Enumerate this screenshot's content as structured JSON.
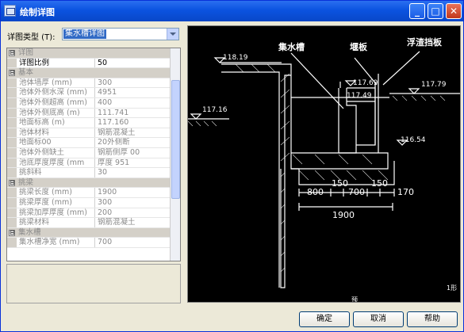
{
  "window": {
    "title": "绘制详图"
  },
  "titlebar": {
    "minimize": "_",
    "maximize": "□",
    "close": "✕"
  },
  "detail_type": {
    "label": "详图类型 (T):",
    "selected": "集水槽详图"
  },
  "properties": [
    {
      "kind": "cat",
      "toggle": "⊟",
      "name": "详图"
    },
    {
      "kind": "prop",
      "name": "详图比例",
      "value": "50",
      "active": true
    },
    {
      "kind": "cat",
      "toggle": "⊟",
      "name": "基本"
    },
    {
      "kind": "prop",
      "name": "池体墙厚 (mm)",
      "value": "300"
    },
    {
      "kind": "prop",
      "name": "池体外侧水深 (mm)",
      "value": "4951"
    },
    {
      "kind": "prop",
      "name": "池体外侧超高 (mm)",
      "value": "400"
    },
    {
      "kind": "prop",
      "name": "池体外侧底高 (m)",
      "value": "111.741"
    },
    {
      "kind": "prop",
      "name": "地面标高 (m)",
      "value": "117.160"
    },
    {
      "kind": "prop",
      "name": "池体材料",
      "value": "钢筋混凝土"
    },
    {
      "kind": "prop",
      "name": "地面标00",
      "value": "20外侧断"
    },
    {
      "kind": "prop",
      "name": "池体外侧缺土",
      "value": "钢筋侧厚 00"
    },
    {
      "kind": "prop",
      "name": "池底厚度厚度 (mm",
      "value": "厚度 951"
    },
    {
      "kind": "prop",
      "name": "挑斜料",
      "value": "30"
    },
    {
      "kind": "cat",
      "toggle": "⊟",
      "name": "挑梁"
    },
    {
      "kind": "prop",
      "name": "挑梁长度 (mm)",
      "value": "1900"
    },
    {
      "kind": "prop",
      "name": "挑梁厚度 (mm)",
      "value": "300"
    },
    {
      "kind": "prop",
      "name": "挑梁加厚厚度 (mm)",
      "value": "200"
    },
    {
      "kind": "prop",
      "name": "挑梁材料",
      "value": "钢筋混凝土"
    },
    {
      "kind": "cat",
      "toggle": "⊟",
      "name": "集水槽"
    },
    {
      "kind": "prop",
      "name": "集水槽净宽 (mm)",
      "value": "700"
    }
  ],
  "drawing": {
    "label_tank": "集水槽",
    "label_weir": "堰板",
    "label_baffle": "浮渣挡板",
    "elev_ground_high": "118.19",
    "elev_ground_left": "117.16",
    "elev_water": "117.79",
    "elev_weir_top": "117.69",
    "elev_weir_inner": "117.49",
    "elev_channel_bottom": "116.54",
    "dim_800": "800",
    "dim_150a": "150",
    "dim_700": "700",
    "dim_150b": "150",
    "dim_170": "170",
    "dim_1900": "1900",
    "partial_right": "1形",
    "partial_bottom": "预"
  },
  "buttons": {
    "ok": "确定",
    "cancel": "取消",
    "help": "帮助"
  },
  "colors": {
    "title_bar": "#0b53e0",
    "drawing_bg": "#000000",
    "line_white": "#ffffff"
  }
}
